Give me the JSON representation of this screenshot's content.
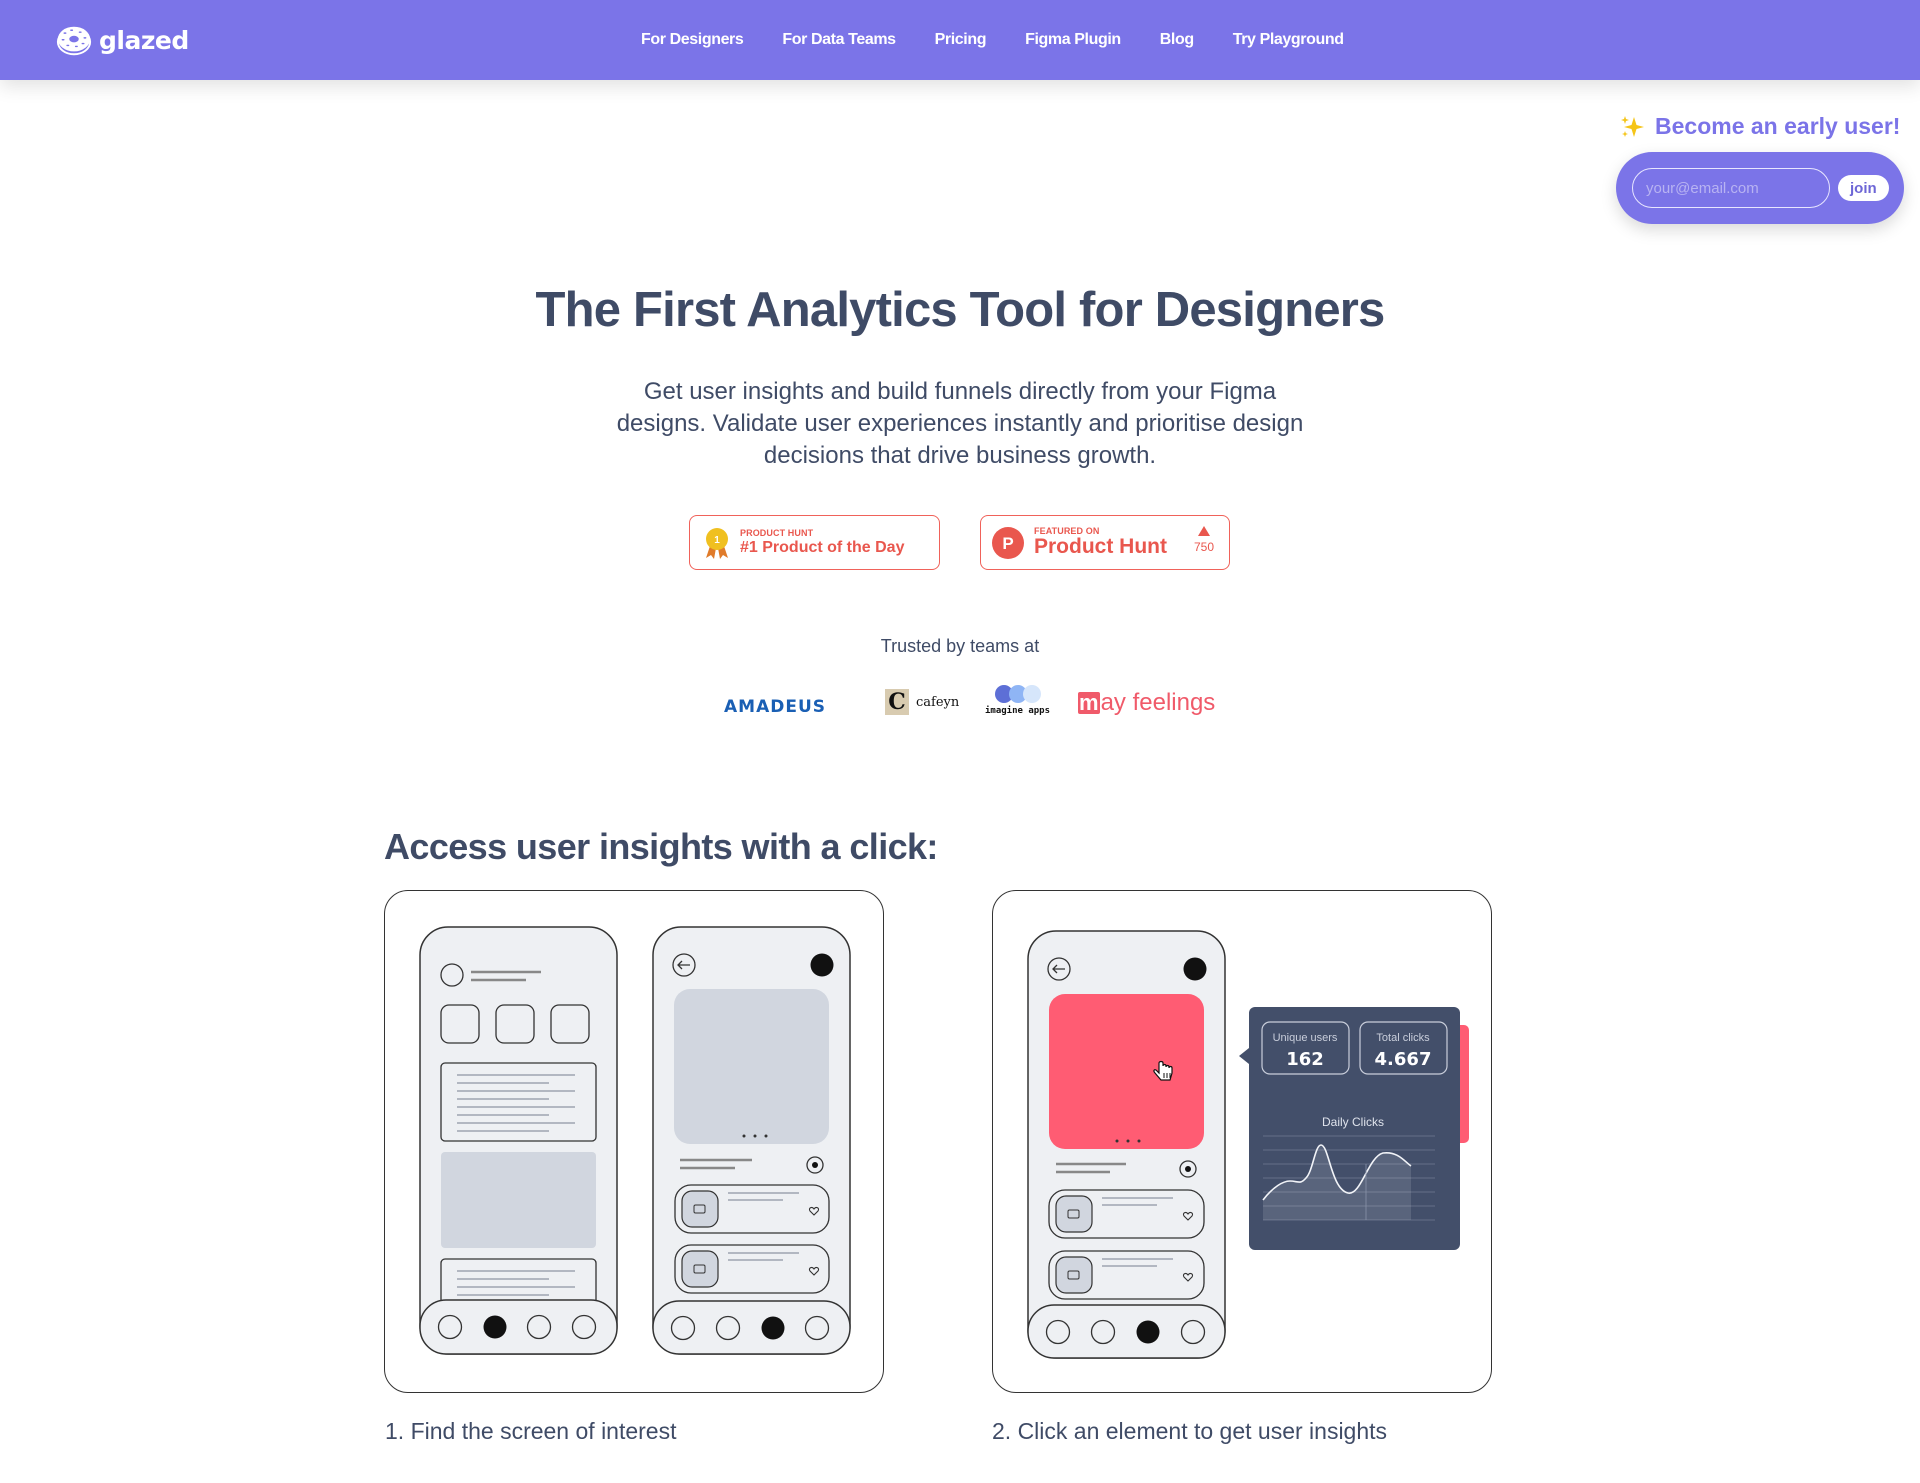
{
  "nav": {
    "brand": "glazed",
    "links": [
      {
        "label": "For Designers"
      },
      {
        "label": "For Data Teams"
      },
      {
        "label": "Pricing"
      },
      {
        "label": "Figma Plugin"
      },
      {
        "label": "Blog"
      },
      {
        "label": "Try Playground"
      }
    ]
  },
  "early_user": {
    "title": "Become an early user!",
    "email_placeholder": "your@email.com",
    "email_value": "",
    "join_label": "join"
  },
  "hero": {
    "title": "The First Analytics Tool for Designers",
    "subtitle": "Get user insights and build funnels directly from your Figma designs. Validate user experiences instantly and prioritise design decisions that drive business growth."
  },
  "badges": [
    {
      "kicker": "PRODUCT HUNT",
      "title": "#1 Product of the Day",
      "medal_rank": "1"
    },
    {
      "kicker": "FEATURED ON",
      "title": "Product Hunt",
      "icon_letter": "P",
      "votes": "750"
    }
  ],
  "trusted": {
    "label": "Trusted by teams at",
    "logos": [
      "amadeus",
      "cafeyn",
      "imagine apps",
      "may feelings"
    ]
  },
  "insights": {
    "title": "Access user insights with a click:",
    "steps": [
      {
        "caption": "1. Find the screen of interest"
      },
      {
        "caption": "2. Click an element to get user insights"
      }
    ],
    "tooltip": {
      "stats": [
        {
          "label": "Unique users",
          "value": "162"
        },
        {
          "label": "Total clicks",
          "value": "4.667"
        }
      ],
      "chart_title": "Daily Clicks"
    }
  },
  "colors": {
    "brand": "#7b74e8",
    "heading": "#3f4b66",
    "product_hunt": "#e9574e",
    "highlight": "#ff5c73",
    "tooltip_bg": "#434f6a"
  }
}
